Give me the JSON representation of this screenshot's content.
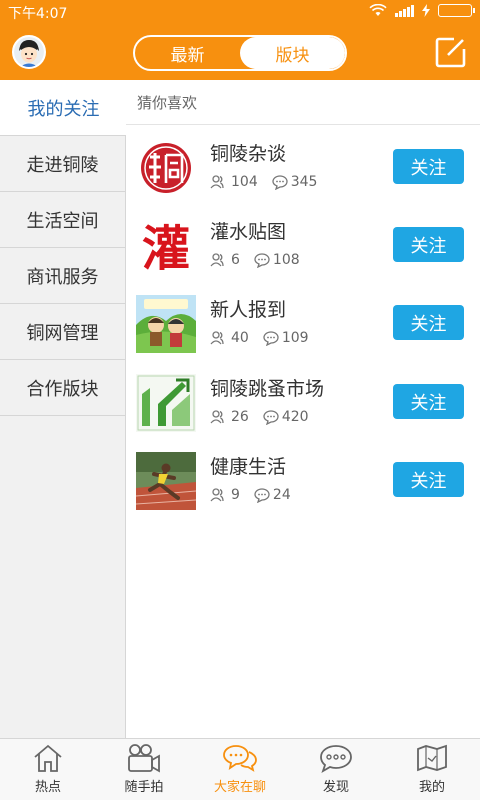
{
  "status": {
    "time": "下午4:07"
  },
  "header": {
    "tabs": [
      {
        "label": "最新",
        "active": false
      },
      {
        "label": "版块",
        "active": true
      }
    ],
    "accent_color": "#f7900f"
  },
  "sidebar": {
    "items": [
      {
        "label": "我的关注",
        "active": true
      },
      {
        "label": "走进铜陵"
      },
      {
        "label": "生活空间"
      },
      {
        "label": "商讯服务"
      },
      {
        "label": "铜网管理"
      },
      {
        "label": "合作版块"
      }
    ]
  },
  "main": {
    "section_title": "猜你喜欢",
    "forums": [
      {
        "name": "铜陵杂谈",
        "members": "104",
        "posts": "345",
        "follow_label": "关注",
        "thumb_icon": "tongling-seal-icon"
      },
      {
        "name": "灌水贴图",
        "members": "6",
        "posts": "108",
        "follow_label": "关注",
        "thumb_icon": "guan-character-icon"
      },
      {
        "name": "新人报到",
        "members": "40",
        "posts": "109",
        "follow_label": "关注",
        "thumb_icon": "newcomer-cartoon-icon"
      },
      {
        "name": "铜陵跳蚤市场",
        "members": "26",
        "posts": "420",
        "follow_label": "关注",
        "thumb_icon": "market-arrow-icon"
      },
      {
        "name": "健康生活",
        "members": "9",
        "posts": "24",
        "follow_label": "关注",
        "thumb_icon": "runner-photo-icon"
      }
    ],
    "follow_color": "#1fa6e3"
  },
  "tabbar": {
    "items": [
      {
        "label": "热点",
        "icon": "home-icon"
      },
      {
        "label": "随手拍",
        "icon": "video-camera-icon"
      },
      {
        "label": "大家在聊",
        "icon": "chat-bubbles-icon",
        "active": true
      },
      {
        "label": "发现",
        "icon": "speech-bubble-icon"
      },
      {
        "label": "我的",
        "icon": "map-icon"
      }
    ]
  }
}
